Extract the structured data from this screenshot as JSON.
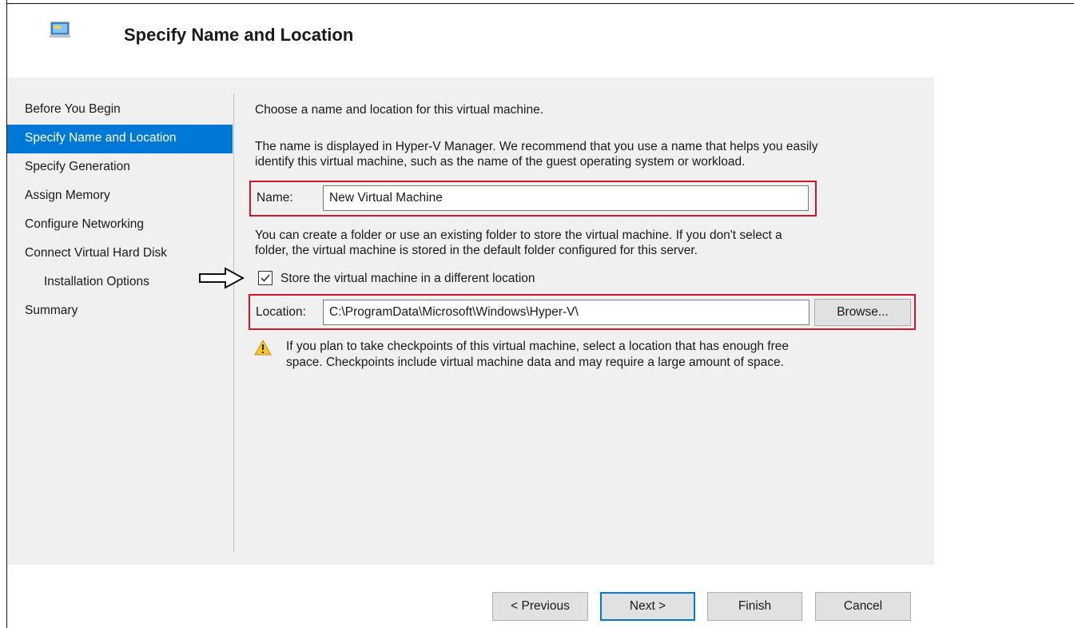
{
  "header": {
    "title": "Specify Name and Location",
    "icon": "virtual-machine-icon"
  },
  "nav": {
    "items": [
      {
        "label": "Before You Begin",
        "active": false,
        "sub": false
      },
      {
        "label": "Specify Name and Location",
        "active": true,
        "sub": false
      },
      {
        "label": "Specify Generation",
        "active": false,
        "sub": false
      },
      {
        "label": "Assign Memory",
        "active": false,
        "sub": false
      },
      {
        "label": "Configure Networking",
        "active": false,
        "sub": false
      },
      {
        "label": "Connect Virtual Hard Disk",
        "active": false,
        "sub": false
      },
      {
        "label": "Installation Options",
        "active": false,
        "sub": true
      },
      {
        "label": "Summary",
        "active": false,
        "sub": false
      }
    ]
  },
  "main": {
    "intro": "Choose a name and location for this virtual machine.",
    "name_help_1": "The name is displayed in Hyper-V Manager. We recommend that you use a name that helps you easily",
    "name_help_2": "identify this virtual machine, such as the name of the guest operating system or workload.",
    "name_label": "Name:",
    "name_value": "New Virtual Machine",
    "folder_help_1": "You can create a folder or use an existing folder to store the virtual machine. If you don't select a",
    "folder_help_2": "folder, the virtual machine is stored in the default folder configured for this server.",
    "store_checkbox_label": "Store the virtual machine in a different location",
    "store_checked": true,
    "location_label": "Location:",
    "location_value": "C:\\ProgramData\\Microsoft\\Windows\\Hyper-V\\",
    "browse_label": "Browse...",
    "warning_1": "If you plan to take checkpoints of this virtual machine, select a location that has enough free",
    "warning_2": "space. Checkpoints include virtual machine data and may require a large amount of space."
  },
  "footer": {
    "previous_label": "< Previous",
    "next_label": "Next >",
    "finish_label": "Finish",
    "cancel_label": "Cancel"
  },
  "colors": {
    "accent": "#0078d7",
    "highlight_box": "#d0182a",
    "panel": "#f0f0f0"
  }
}
